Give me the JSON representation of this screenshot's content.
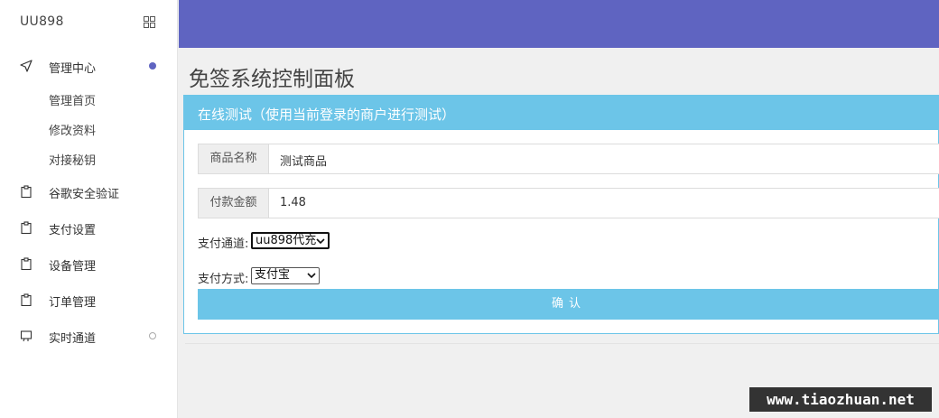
{
  "sidebar": {
    "brand": "UU898",
    "items": [
      {
        "label": "管理中心",
        "icon": "send-icon",
        "dot": "filled"
      },
      {
        "label": "谷歌安全验证",
        "icon": "clipboard-icon"
      },
      {
        "label": "支付设置",
        "icon": "clipboard-icon"
      },
      {
        "label": "设备管理",
        "icon": "clipboard-icon"
      },
      {
        "label": "订单管理",
        "icon": "clipboard-icon"
      },
      {
        "label": "实时通道",
        "icon": "monitor-icon",
        "dot": "hollow"
      }
    ],
    "subitems": [
      "管理首页",
      "修改资料",
      "对接秘钥"
    ]
  },
  "main": {
    "title": "免签系统控制面板",
    "panel": {
      "heading": "在线测试（使用当前登录的商户进行测试）",
      "fields": [
        {
          "label": "商品名称",
          "value": "测试商品"
        },
        {
          "label": "付款金额",
          "value": "1.48"
        }
      ],
      "channel": {
        "label": "支付通道:",
        "selected": "uu898代充"
      },
      "method": {
        "label": "支付方式:",
        "selected": "支付宝"
      },
      "confirm_label": "确认"
    }
  },
  "watermark": "www.tiaozhuan.net",
  "colors": {
    "topbar": "#5f64c1",
    "accent": "#6cc5e8",
    "active_dot": "#5f64c1"
  }
}
